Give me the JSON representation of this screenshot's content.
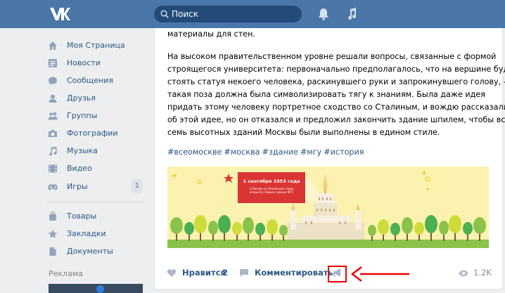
{
  "header": {
    "search_placeholder": "Поиск"
  },
  "sidebar": {
    "items": [
      {
        "label": "Моя Страница",
        "icon": "home-icon"
      },
      {
        "label": "Новости",
        "icon": "news-icon"
      },
      {
        "label": "Сообщения",
        "icon": "messages-icon"
      },
      {
        "label": "Друзья",
        "icon": "friend-icon"
      },
      {
        "label": "Группы",
        "icon": "groups-icon"
      },
      {
        "label": "Фотографии",
        "icon": "camera-icon"
      },
      {
        "label": "Музыка",
        "icon": "music-icon"
      },
      {
        "label": "Видео",
        "icon": "video-icon"
      },
      {
        "label": "Игры",
        "icon": "gamepad-icon",
        "badge": "1"
      },
      {
        "label": "Товары",
        "icon": "shopping-bag-icon"
      },
      {
        "label": "Закладки",
        "icon": "star-icon"
      },
      {
        "label": "Документы",
        "icon": "document-icon"
      }
    ],
    "ads_label": "Реклама"
  },
  "post": {
    "lines": [
      "материалы для стен.",
      "На высоком правительственном уровне решали вопросы, связанные с формой",
      "строящегося университета: первоначально предполагалось, что на вершине будет",
      "стоять статуя некоего человека, раскинувшего руки и запрокинувшего голову, -",
      "такая поза должна была символизировать тягу к знаниям. Была даже идея",
      "придать этому человеку портретное сходство со Сталиным, и вождю рассказали",
      "об этой идее, но он отказался и предложил закончить здание шпилем, чтобы все",
      "семь высотных зданий Москвы были выполнены в едином стиле."
    ],
    "hashtags": [
      "#всеомоскве",
      "#москва",
      "#здание",
      "#мгу",
      "#история"
    ],
    "image": {
      "banner_date": "1 сентября 1953 года",
      "banner_text": "в Москве на Ленинских горах открыто главное здание МГУ"
    },
    "actions": {
      "like_label": "Нравится",
      "like_count": "2",
      "comment_label": "Комментировать",
      "views": "1.2K"
    }
  },
  "colors": {
    "header_bg": "#4a76a8",
    "link": "#2a5885",
    "annotation": "#e00000"
  }
}
